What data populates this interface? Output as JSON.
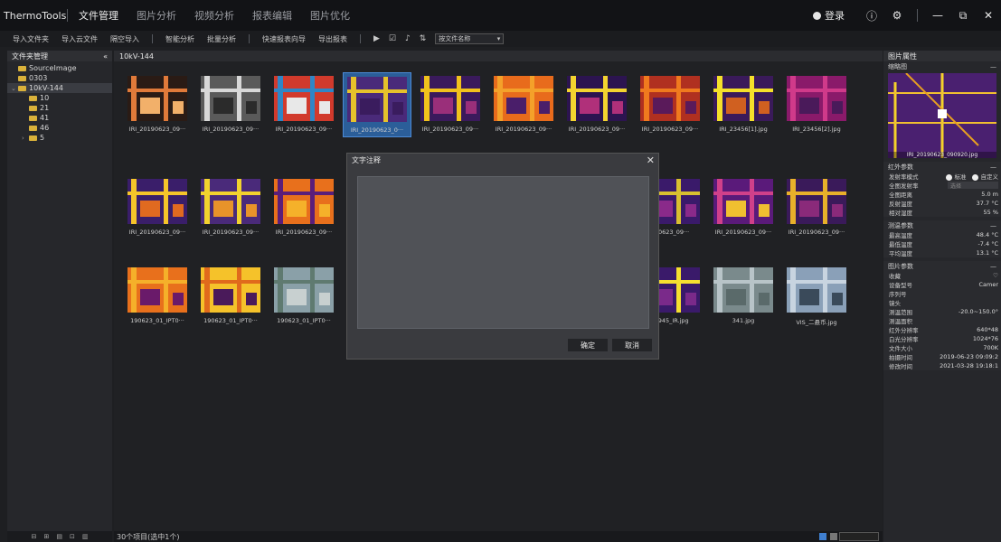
{
  "app": {
    "title": "ThermoTools"
  },
  "tabs": [
    "文件管理",
    "图片分析",
    "视频分析",
    "报表编辑",
    "图片优化"
  ],
  "active_tab": 0,
  "window": {
    "login_label": "登录",
    "help_icon": "help-icon",
    "settings_icon": "gear-icon",
    "min": "—",
    "restore": "⧉",
    "close": "✕"
  },
  "toolbar": {
    "import_folder": "导入文件夹",
    "import_cloud": "导入云文件",
    "aerial_import": "隔空导入",
    "smart_analysis": "智能分析",
    "batch_analysis": "批量分析",
    "quick_report": "快速报表向导",
    "export_report": "导出报表",
    "sort_select": "按文件名称"
  },
  "left_panel": {
    "title": "文件夹管理",
    "collapse": "«",
    "tree": [
      {
        "label": "SourceImage",
        "level": 0,
        "caret": ""
      },
      {
        "label": "0303",
        "level": 0,
        "caret": ""
      },
      {
        "label": "10kV-144",
        "level": 0,
        "caret": "⌄"
      },
      {
        "label": "10",
        "level": 1,
        "caret": ""
      },
      {
        "label": "21",
        "level": 1,
        "caret": ""
      },
      {
        "label": "41",
        "level": 1,
        "caret": ""
      },
      {
        "label": "46",
        "level": 1,
        "caret": ""
      },
      {
        "label": "5",
        "level": 1,
        "caret": "›"
      }
    ],
    "selected_index": 2
  },
  "center": {
    "breadcrumb": "10kV-144",
    "status": "30个项目(选中1个)",
    "thumbnails": [
      {
        "label": "IRI_20190623_09···",
        "col": 0,
        "row": 0,
        "colors": [
          "#2a1b15",
          "#e07a3a",
          "#f2b06a"
        ]
      },
      {
        "label": "IRI_20190623_09···",
        "col": 1,
        "row": 0,
        "colors": [
          "#5a5a5a",
          "#d8d8d8",
          "#2b2b2b"
        ]
      },
      {
        "label": "IRI_20190623_09···",
        "col": 2,
        "row": 0,
        "colors": [
          "#d13a2c",
          "#2f86c6",
          "#e8e8e8"
        ]
      },
      {
        "label": "IRI_20190623_0···",
        "col": 3,
        "row": 0,
        "colors": [
          "#4a2a7a",
          "#e6c22b",
          "#3a1c5e"
        ]
      },
      {
        "label": "IRI_20190623_09···",
        "col": 4,
        "row": 0,
        "colors": [
          "#3a1a5c",
          "#f1c21c",
          "#9a2f7a"
        ]
      },
      {
        "label": "IRI_20190623_09···",
        "col": 5,
        "row": 0,
        "colors": [
          "#e86b1c",
          "#f4a12a",
          "#4a1e6a"
        ]
      },
      {
        "label": "IRI_20190623_09···",
        "col": 6,
        "row": 0,
        "colors": [
          "#2c1450",
          "#f3d42f",
          "#b0307a"
        ]
      },
      {
        "label": "IRI_20190623_09···",
        "col": 7,
        "row": 0,
        "colors": [
          "#b03020",
          "#f07a1e",
          "#5a1a5a"
        ]
      },
      {
        "label": "IRI_23456[1].jpg",
        "col": 8,
        "row": 0,
        "colors": [
          "#3a1a5a",
          "#f5e02a",
          "#d06020"
        ]
      },
      {
        "label": "IRI_23456[2].jpg",
        "col": 9,
        "row": 0,
        "colors": [
          "#8a1a6a",
          "#d03a8a",
          "#4a1a5a"
        ]
      },
      {
        "label": "IRI_20190623_09···",
        "col": 0,
        "row": 1,
        "colors": [
          "#3a1e6a",
          "#f5c42a",
          "#e06a20"
        ]
      },
      {
        "label": "IRI_20190623_09···",
        "col": 1,
        "row": 1,
        "colors": [
          "#4a2a7a",
          "#f2d22e",
          "#e8932a"
        ]
      },
      {
        "label": "IRI_20190623_09···",
        "col": 2,
        "row": 1,
        "colors": [
          "#e8701c",
          "#5a1e7a",
          "#f5b12a"
        ]
      },
      {
        "label": "190623_09···",
        "col": 7,
        "row": 1,
        "colors": [
          "#3a1a6a",
          "#d8c030",
          "#8a2a8a"
        ]
      },
      {
        "label": "IRI_20190623_09···",
        "col": 8,
        "row": 1,
        "colors": [
          "#5a1a7a",
          "#d0408a",
          "#f0c030"
        ]
      },
      {
        "label": "IRI_20190623_09···",
        "col": 9,
        "row": 1,
        "colors": [
          "#3a1a5a",
          "#e8b02a",
          "#8a2a7a"
        ]
      },
      {
        "label": "190623_01_IPT0···",
        "col": 0,
        "row": 2,
        "colors": [
          "#e8701c",
          "#f5b02a",
          "#6a1a6a"
        ]
      },
      {
        "label": "190623_01_IPT0···",
        "col": 1,
        "row": 2,
        "colors": [
          "#f5c22a",
          "#e06a1c",
          "#4a1a5a"
        ]
      },
      {
        "label": "190623_01_IPT0···",
        "col": 2,
        "row": 2,
        "colors": [
          "#8aa0a8",
          "#5f7a70",
          "#c8d0d0"
        ]
      },
      {
        "label": "7_945_IR.jpg",
        "col": 7,
        "row": 2,
        "colors": [
          "#3a1a6a",
          "#f5e030",
          "#7a2a8a"
        ]
      },
      {
        "label": "341.jpg",
        "col": 8,
        "row": 2,
        "colors": [
          "#7a8a8c",
          "#b8c4c8",
          "#5a6a6a"
        ]
      },
      {
        "label": "VIS_二悬币.jpg",
        "col": 9,
        "row": 2,
        "colors": [
          "#8aa0b8",
          "#c8d4e0",
          "#3a4a5a"
        ]
      }
    ],
    "selected_thumbnail_index": 3
  },
  "right_panel": {
    "title": "图片属性",
    "thumbnail_section": "缩略图",
    "preview_caption": "IRI_20190623_090920.jpg",
    "ir_params": {
      "title": "红外参数",
      "emissivity_mode_label": "发射率模式",
      "mode_standard": "标准",
      "mode_custom": "自定义",
      "global_emissivity_label": "全图发射率",
      "global_emissivity_placeholder": "选择",
      "rows": [
        {
          "label": "全图距离",
          "value": "5.0 m"
        },
        {
          "label": "反射温度",
          "value": "37.7 °C"
        },
        {
          "label": "相对湿度",
          "value": "55 %"
        }
      ]
    },
    "temp_params": {
      "title": "测温参数",
      "rows": [
        {
          "label": "最高温度",
          "value": "48.4 °C"
        },
        {
          "label": "最低温度",
          "value": "-7.4 °C"
        },
        {
          "label": "平均温度",
          "value": "13.1 °C"
        }
      ]
    },
    "image_params": {
      "title": "图片参数",
      "favorite_label": "收藏",
      "rows": [
        {
          "label": "设备型号",
          "value": "Camer"
        },
        {
          "label": "序列号",
          "value": ""
        },
        {
          "label": "镜头",
          "value": ""
        },
        {
          "label": "测温范围",
          "value": "-20.0~150.0°"
        },
        {
          "label": "测温面积",
          "value": ""
        },
        {
          "label": "红外分辨率",
          "value": "640*48"
        },
        {
          "label": "白光分辨率",
          "value": "1024*76"
        },
        {
          "label": "文件大小",
          "value": "700K"
        },
        {
          "label": "拍摄时间",
          "value": "2019-06-23 09:09:2"
        },
        {
          "label": "修改时间",
          "value": "2021-03-28 19:18:1"
        }
      ]
    }
  },
  "dialog": {
    "title": "文字注释",
    "text": "",
    "ok": "确定",
    "cancel": "取消",
    "close": "✕"
  }
}
